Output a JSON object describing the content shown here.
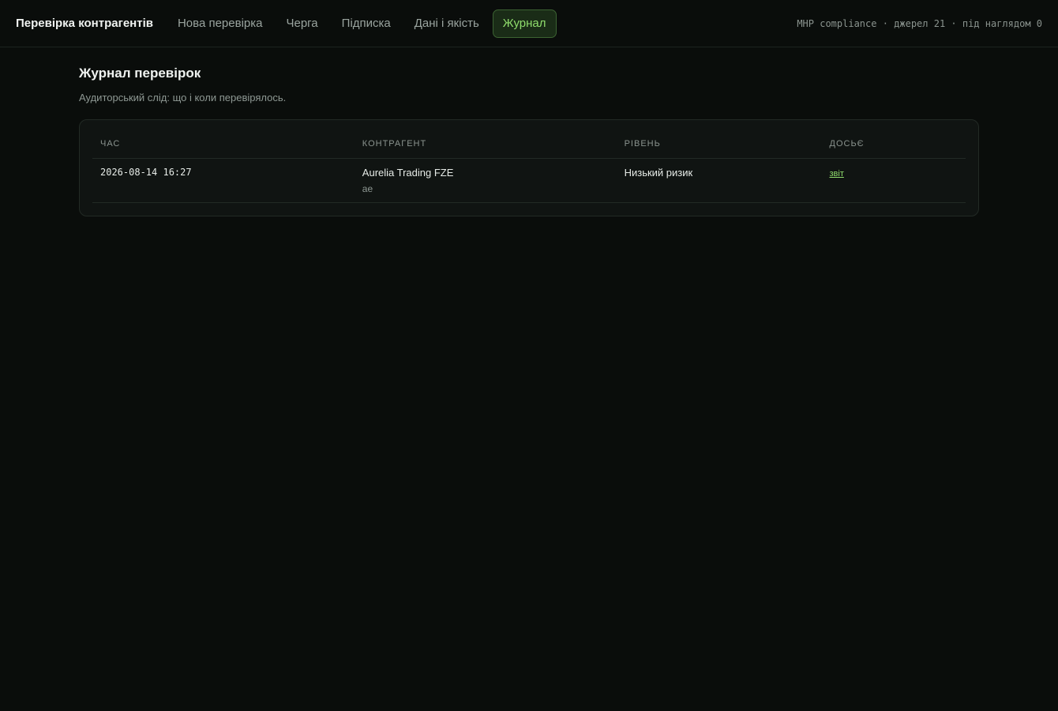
{
  "header": {
    "brand": "Перевірка контрагентів",
    "nav": [
      {
        "label": "Нова перевірка"
      },
      {
        "label": "Черга"
      },
      {
        "label": "Підписка"
      },
      {
        "label": "Дані і якість"
      },
      {
        "label": "Журнал"
      }
    ],
    "status": "МНР compliance · джерел 21 · під наглядом 0"
  },
  "page": {
    "title": "Журнал перевірок",
    "subtitle": "Аудиторський слід: що і коли перевірялось."
  },
  "table": {
    "columns": [
      "ЧАС",
      "КОНТРАГЕНТ",
      "РІВЕНЬ",
      "ДОСЬЄ"
    ],
    "rows": [
      {
        "time": "2026-08-14 16:27",
        "counterparty": "Aurelia Trading FZE",
        "country": "ae",
        "level": "Низький ризик",
        "dossier": "звіт"
      }
    ]
  },
  "colors": {
    "accent": "#8fdc6c",
    "background": "#0a0d0b"
  }
}
